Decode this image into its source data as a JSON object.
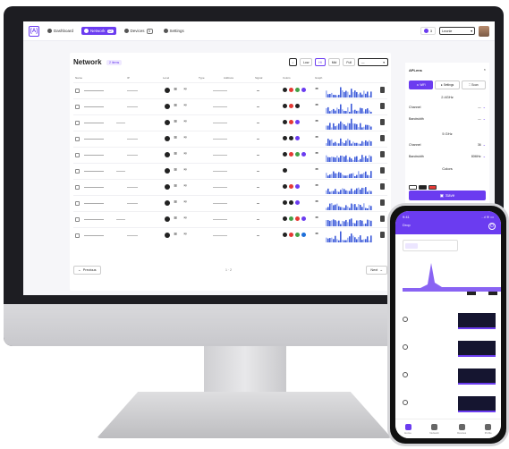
{
  "colors": {
    "accent": "#6b3cf0",
    "dark": "#1d1d22",
    "spark": "#3d5bd9",
    "spark_light": "#9fb1f2"
  },
  "topnav": {
    "logo": "[A]",
    "items": [
      {
        "label": "Dashboard",
        "icon": "dashboard-icon"
      },
      {
        "label": "Network",
        "badge": "12",
        "icon": "network-icon"
      },
      {
        "label": "Devices",
        "badge": "5",
        "icon": "devices-icon"
      },
      {
        "label": "Settings",
        "icon": "gear-icon"
      }
    ],
    "notif_count": "3",
    "select_value": "Leonie"
  },
  "network": {
    "title": "Network",
    "tag": "2 items",
    "filters": [
      "Low",
      "Hi",
      "Mid",
      "Full"
    ],
    "headers": [
      "Name",
      "IP",
      "Level",
      "Type",
      "Address",
      "Signal",
      "Colors",
      "Graph"
    ],
    "previous_label": "Previous",
    "next_label": "Next",
    "page_label": "1 · 2"
  },
  "rows": [
    {
      "lights": [
        "#222",
        "#e53935",
        "#43a047",
        "#6b3cf0"
      ]
    },
    {
      "lights": [
        "#222",
        "#e53935",
        "#222"
      ]
    },
    {
      "lights": [
        "#222",
        "#e53935",
        "#6b3cf0"
      ]
    },
    {
      "lights": [
        "#222",
        "#222",
        "#6b3cf0"
      ]
    },
    {
      "lights": [
        "#222",
        "#e53935",
        "#43a047",
        "#6b3cf0"
      ]
    },
    {
      "lights": [
        "#222"
      ]
    },
    {
      "lights": [
        "#222",
        "#e53935",
        "#6b3cf0"
      ]
    },
    {
      "lights": [
        "#222",
        "#222",
        "#6b3cf0"
      ]
    },
    {
      "lights": [
        "#222",
        "#43a047",
        "#e53935",
        "#6b3cf0"
      ]
    },
    {
      "lights": [
        "#222",
        "#e53935",
        "#43a047",
        "#1e6fd9"
      ]
    }
  ],
  "settings_panel": {
    "title": "APLens",
    "tabs": [
      "WiFi",
      "Settings",
      "Scan"
    ],
    "band_1": "2.4GHz",
    "band_2": "5 GHz",
    "colors_label": "Colors",
    "channel_label": "Channel",
    "bandwidth_label": "Bandwidth",
    "ch1_value": "—",
    "bw1_value": "—",
    "ch2_value": "36",
    "bw2_value": "80MHz",
    "save_label": "Save",
    "swatch_colors": [
      "#ffffff",
      "#222222",
      "#e53935"
    ],
    "edit_label": "Edit"
  },
  "phone": {
    "time": "9:41",
    "signal": "..ıl ≋ ▭",
    "title": "Drop",
    "tabs": [
      "Home",
      "Network",
      "Devices",
      "Profile"
    ]
  }
}
